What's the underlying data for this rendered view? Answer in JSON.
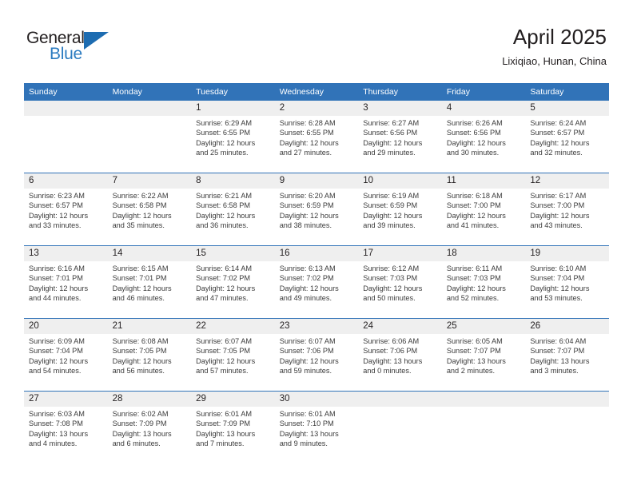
{
  "brand": {
    "name_top": "General",
    "name_bottom": "Blue",
    "accent_color": "#2b7bc0",
    "triangle_color": "#1d6cb1"
  },
  "header": {
    "title": "April 2025",
    "subtitle": "Lixiqiao, Hunan, China"
  },
  "theme": {
    "header_blue": "#3173b8",
    "daynum_band": "#efefef",
    "text": "#231f20",
    "detail_text": "#3b3b3b"
  },
  "weekday_headers": [
    "Sunday",
    "Monday",
    "Tuesday",
    "Wednesday",
    "Thursday",
    "Friday",
    "Saturday"
  ],
  "weeks": [
    {
      "days": [
        {
          "num": "",
          "sunrise": "",
          "sunset": "",
          "daylight_line1": "",
          "daylight_line2": ""
        },
        {
          "num": "",
          "sunrise": "",
          "sunset": "",
          "daylight_line1": "",
          "daylight_line2": ""
        },
        {
          "num": "1",
          "sunrise": "Sunrise: 6:29 AM",
          "sunset": "Sunset: 6:55 PM",
          "daylight_line1": "Daylight: 12 hours",
          "daylight_line2": "and 25 minutes."
        },
        {
          "num": "2",
          "sunrise": "Sunrise: 6:28 AM",
          "sunset": "Sunset: 6:55 PM",
          "daylight_line1": "Daylight: 12 hours",
          "daylight_line2": "and 27 minutes."
        },
        {
          "num": "3",
          "sunrise": "Sunrise: 6:27 AM",
          "sunset": "Sunset: 6:56 PM",
          "daylight_line1": "Daylight: 12 hours",
          "daylight_line2": "and 29 minutes."
        },
        {
          "num": "4",
          "sunrise": "Sunrise: 6:26 AM",
          "sunset": "Sunset: 6:56 PM",
          "daylight_line1": "Daylight: 12 hours",
          "daylight_line2": "and 30 minutes."
        },
        {
          "num": "5",
          "sunrise": "Sunrise: 6:24 AM",
          "sunset": "Sunset: 6:57 PM",
          "daylight_line1": "Daylight: 12 hours",
          "daylight_line2": "and 32 minutes."
        }
      ]
    },
    {
      "days": [
        {
          "num": "6",
          "sunrise": "Sunrise: 6:23 AM",
          "sunset": "Sunset: 6:57 PM",
          "daylight_line1": "Daylight: 12 hours",
          "daylight_line2": "and 33 minutes."
        },
        {
          "num": "7",
          "sunrise": "Sunrise: 6:22 AM",
          "sunset": "Sunset: 6:58 PM",
          "daylight_line1": "Daylight: 12 hours",
          "daylight_line2": "and 35 minutes."
        },
        {
          "num": "8",
          "sunrise": "Sunrise: 6:21 AM",
          "sunset": "Sunset: 6:58 PM",
          "daylight_line1": "Daylight: 12 hours",
          "daylight_line2": "and 36 minutes."
        },
        {
          "num": "9",
          "sunrise": "Sunrise: 6:20 AM",
          "sunset": "Sunset: 6:59 PM",
          "daylight_line1": "Daylight: 12 hours",
          "daylight_line2": "and 38 minutes."
        },
        {
          "num": "10",
          "sunrise": "Sunrise: 6:19 AM",
          "sunset": "Sunset: 6:59 PM",
          "daylight_line1": "Daylight: 12 hours",
          "daylight_line2": "and 39 minutes."
        },
        {
          "num": "11",
          "sunrise": "Sunrise: 6:18 AM",
          "sunset": "Sunset: 7:00 PM",
          "daylight_line1": "Daylight: 12 hours",
          "daylight_line2": "and 41 minutes."
        },
        {
          "num": "12",
          "sunrise": "Sunrise: 6:17 AM",
          "sunset": "Sunset: 7:00 PM",
          "daylight_line1": "Daylight: 12 hours",
          "daylight_line2": "and 43 minutes."
        }
      ]
    },
    {
      "days": [
        {
          "num": "13",
          "sunrise": "Sunrise: 6:16 AM",
          "sunset": "Sunset: 7:01 PM",
          "daylight_line1": "Daylight: 12 hours",
          "daylight_line2": "and 44 minutes."
        },
        {
          "num": "14",
          "sunrise": "Sunrise: 6:15 AM",
          "sunset": "Sunset: 7:01 PM",
          "daylight_line1": "Daylight: 12 hours",
          "daylight_line2": "and 46 minutes."
        },
        {
          "num": "15",
          "sunrise": "Sunrise: 6:14 AM",
          "sunset": "Sunset: 7:02 PM",
          "daylight_line1": "Daylight: 12 hours",
          "daylight_line2": "and 47 minutes."
        },
        {
          "num": "16",
          "sunrise": "Sunrise: 6:13 AM",
          "sunset": "Sunset: 7:02 PM",
          "daylight_line1": "Daylight: 12 hours",
          "daylight_line2": "and 49 minutes."
        },
        {
          "num": "17",
          "sunrise": "Sunrise: 6:12 AM",
          "sunset": "Sunset: 7:03 PM",
          "daylight_line1": "Daylight: 12 hours",
          "daylight_line2": "and 50 minutes."
        },
        {
          "num": "18",
          "sunrise": "Sunrise: 6:11 AM",
          "sunset": "Sunset: 7:03 PM",
          "daylight_line1": "Daylight: 12 hours",
          "daylight_line2": "and 52 minutes."
        },
        {
          "num": "19",
          "sunrise": "Sunrise: 6:10 AM",
          "sunset": "Sunset: 7:04 PM",
          "daylight_line1": "Daylight: 12 hours",
          "daylight_line2": "and 53 minutes."
        }
      ]
    },
    {
      "days": [
        {
          "num": "20",
          "sunrise": "Sunrise: 6:09 AM",
          "sunset": "Sunset: 7:04 PM",
          "daylight_line1": "Daylight: 12 hours",
          "daylight_line2": "and 54 minutes."
        },
        {
          "num": "21",
          "sunrise": "Sunrise: 6:08 AM",
          "sunset": "Sunset: 7:05 PM",
          "daylight_line1": "Daylight: 12 hours",
          "daylight_line2": "and 56 minutes."
        },
        {
          "num": "22",
          "sunrise": "Sunrise: 6:07 AM",
          "sunset": "Sunset: 7:05 PM",
          "daylight_line1": "Daylight: 12 hours",
          "daylight_line2": "and 57 minutes."
        },
        {
          "num": "23",
          "sunrise": "Sunrise: 6:07 AM",
          "sunset": "Sunset: 7:06 PM",
          "daylight_line1": "Daylight: 12 hours",
          "daylight_line2": "and 59 minutes."
        },
        {
          "num": "24",
          "sunrise": "Sunrise: 6:06 AM",
          "sunset": "Sunset: 7:06 PM",
          "daylight_line1": "Daylight: 13 hours",
          "daylight_line2": "and 0 minutes."
        },
        {
          "num": "25",
          "sunrise": "Sunrise: 6:05 AM",
          "sunset": "Sunset: 7:07 PM",
          "daylight_line1": "Daylight: 13 hours",
          "daylight_line2": "and 2 minutes."
        },
        {
          "num": "26",
          "sunrise": "Sunrise: 6:04 AM",
          "sunset": "Sunset: 7:07 PM",
          "daylight_line1": "Daylight: 13 hours",
          "daylight_line2": "and 3 minutes."
        }
      ]
    },
    {
      "days": [
        {
          "num": "27",
          "sunrise": "Sunrise: 6:03 AM",
          "sunset": "Sunset: 7:08 PM",
          "daylight_line1": "Daylight: 13 hours",
          "daylight_line2": "and 4 minutes."
        },
        {
          "num": "28",
          "sunrise": "Sunrise: 6:02 AM",
          "sunset": "Sunset: 7:09 PM",
          "daylight_line1": "Daylight: 13 hours",
          "daylight_line2": "and 6 minutes."
        },
        {
          "num": "29",
          "sunrise": "Sunrise: 6:01 AM",
          "sunset": "Sunset: 7:09 PM",
          "daylight_line1": "Daylight: 13 hours",
          "daylight_line2": "and 7 minutes."
        },
        {
          "num": "30",
          "sunrise": "Sunrise: 6:01 AM",
          "sunset": "Sunset: 7:10 PM",
          "daylight_line1": "Daylight: 13 hours",
          "daylight_line2": "and 9 minutes."
        },
        {
          "num": "",
          "sunrise": "",
          "sunset": "",
          "daylight_line1": "",
          "daylight_line2": ""
        },
        {
          "num": "",
          "sunrise": "",
          "sunset": "",
          "daylight_line1": "",
          "daylight_line2": ""
        },
        {
          "num": "",
          "sunrise": "",
          "sunset": "",
          "daylight_line1": "",
          "daylight_line2": ""
        }
      ]
    }
  ]
}
